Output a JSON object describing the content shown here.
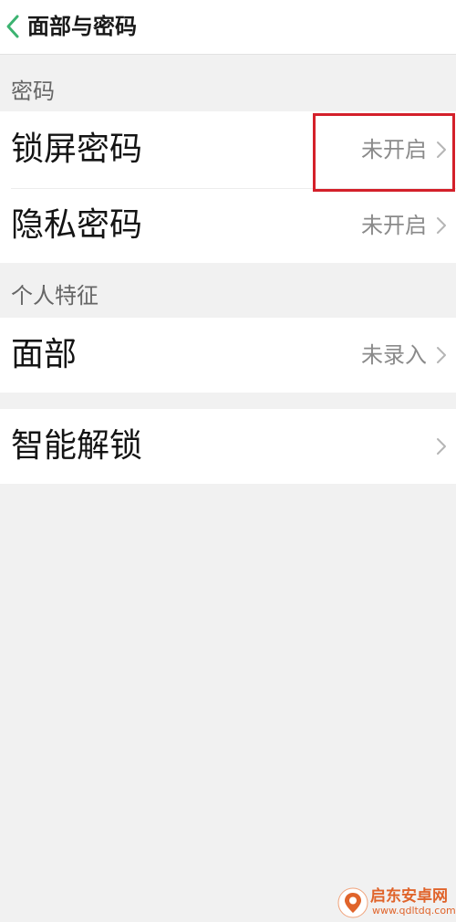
{
  "header": {
    "back_icon": "chevron-left-icon",
    "title": "面部与密码",
    "accent_color": "#3cb371"
  },
  "sections": {
    "password": {
      "label": "密码",
      "items": [
        {
          "label": "锁屏密码",
          "value": "未开启",
          "icon": "chevron-right-icon"
        },
        {
          "label": "隐私密码",
          "value": "未开启",
          "icon": "chevron-right-icon"
        }
      ]
    },
    "personal": {
      "label": "个人特征",
      "items": [
        {
          "label": "面部",
          "value": "未录入",
          "icon": "chevron-right-icon"
        }
      ]
    },
    "smart": {
      "items": [
        {
          "label": "智能解锁",
          "icon": "chevron-right-icon"
        }
      ]
    }
  },
  "highlight": {
    "color": "#d4202a"
  },
  "watermark": {
    "text": "启东安卓网",
    "url": "www.qdltdq.com",
    "color": "#e0642b"
  }
}
